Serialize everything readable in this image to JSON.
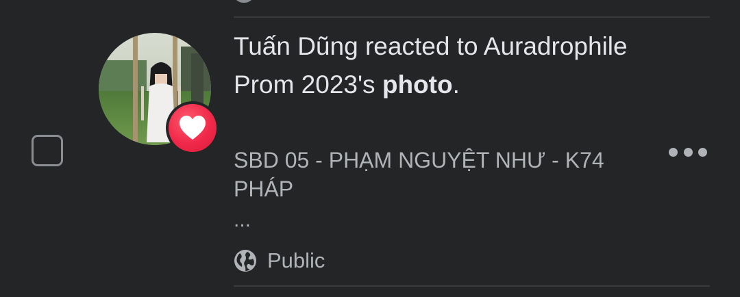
{
  "notification": {
    "actor_name": "Tuấn Dũng",
    "action_text": " reacted to ",
    "target_owner": "Auradrophile Prom 2023's",
    "target_object": "photo",
    "end_punct": ".",
    "preview_text": "SBD 05 - PHẠM NGUYỆT NHƯ - K74 PHÁP",
    "preview_ellipsis": "...",
    "privacy_label": "Public",
    "reaction_type": "heart-icon",
    "more_icon": "more-horizontal-icon",
    "privacy_icon": "globe-icon"
  },
  "colors": {
    "background": "#242526",
    "primary_text": "#e4e6eb",
    "secondary_text": "#b0b3b8",
    "divider": "#3a3b3c",
    "reaction_red": "#f02849"
  }
}
